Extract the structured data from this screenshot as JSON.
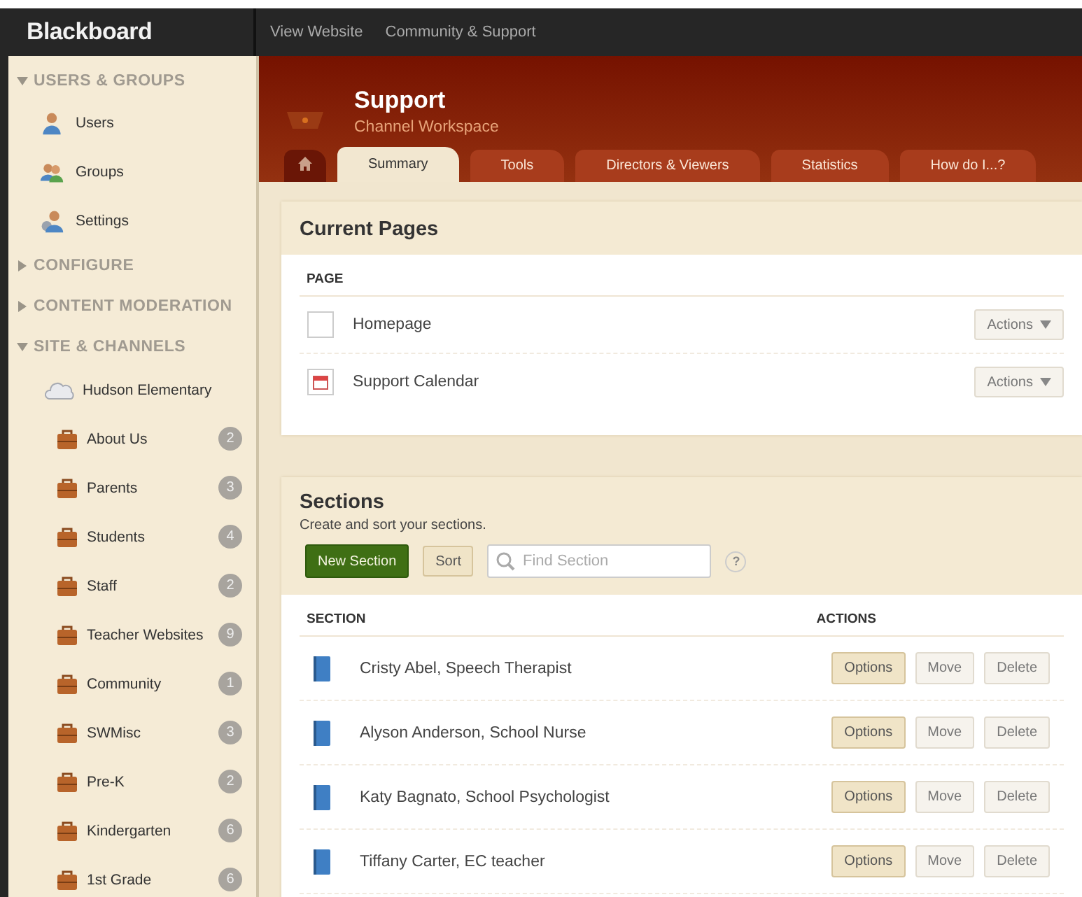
{
  "topbar": {
    "logo": "Blackboard",
    "links": [
      "View Website",
      "Community & Support"
    ]
  },
  "sidebar": {
    "groups": [
      {
        "label": "USERS & GROUPS",
        "expanded": true,
        "items": [
          {
            "label": "Users",
            "kind": "user"
          },
          {
            "label": "Groups",
            "kind": "group"
          },
          {
            "label": "Settings",
            "kind": "settings"
          }
        ]
      },
      {
        "label": "CONFIGURE",
        "expanded": false
      },
      {
        "label": "CONTENT MODERATION",
        "expanded": false
      },
      {
        "label": "SITE & CHANNELS",
        "expanded": true,
        "site": {
          "label": "Hudson Elementary",
          "children": [
            {
              "label": "About Us",
              "count": "2"
            },
            {
              "label": "Parents",
              "count": "3"
            },
            {
              "label": "Students",
              "count": "4"
            },
            {
              "label": "Staff",
              "count": "2"
            },
            {
              "label": "Teacher Websites",
              "count": "9"
            },
            {
              "label": "Community",
              "count": "1"
            },
            {
              "label": "SWMisc",
              "count": "3"
            },
            {
              "label": "Pre-K",
              "count": "2"
            },
            {
              "label": "Kindergarten",
              "count": "6"
            },
            {
              "label": "1st Grade",
              "count": "6"
            }
          ]
        }
      }
    ]
  },
  "header": {
    "title": "Support",
    "subtitle": "Channel Workspace"
  },
  "tabs": [
    {
      "label": "Summary",
      "selected": true
    },
    {
      "label": "Tools",
      "selected": false
    },
    {
      "label": "Directors & Viewers",
      "selected": false
    },
    {
      "label": "Statistics",
      "selected": false
    },
    {
      "label": "How do I...?",
      "selected": false
    }
  ],
  "current_pages": {
    "title": "Current Pages",
    "column": "PAGE",
    "rows": [
      {
        "name": "Homepage",
        "kind": "page",
        "action": "Actions"
      },
      {
        "name": "Support Calendar",
        "kind": "calendar",
        "action": "Actions"
      }
    ]
  },
  "sections": {
    "title": "Sections",
    "subtitle": "Create and sort your sections.",
    "new_button": "New Section",
    "sort_button": "Sort",
    "search": {
      "placeholder": "Find Section"
    },
    "help": "?",
    "columns": [
      "SECTION",
      "ACTIONS"
    ],
    "rows": [
      {
        "name": "Cristy Abel, Speech Therapist",
        "buttons": [
          "Options",
          "Move",
          "Delete"
        ]
      },
      {
        "name": "Alyson Anderson, School Nurse",
        "buttons": [
          "Options",
          "Move",
          "Delete"
        ]
      },
      {
        "name": "Katy Bagnato, School Psychologist",
        "buttons": [
          "Options",
          "Move",
          "Delete"
        ]
      },
      {
        "name": "Tiffany Carter, EC teacher",
        "buttons": [
          "Options",
          "Move",
          "Delete"
        ]
      }
    ]
  }
}
